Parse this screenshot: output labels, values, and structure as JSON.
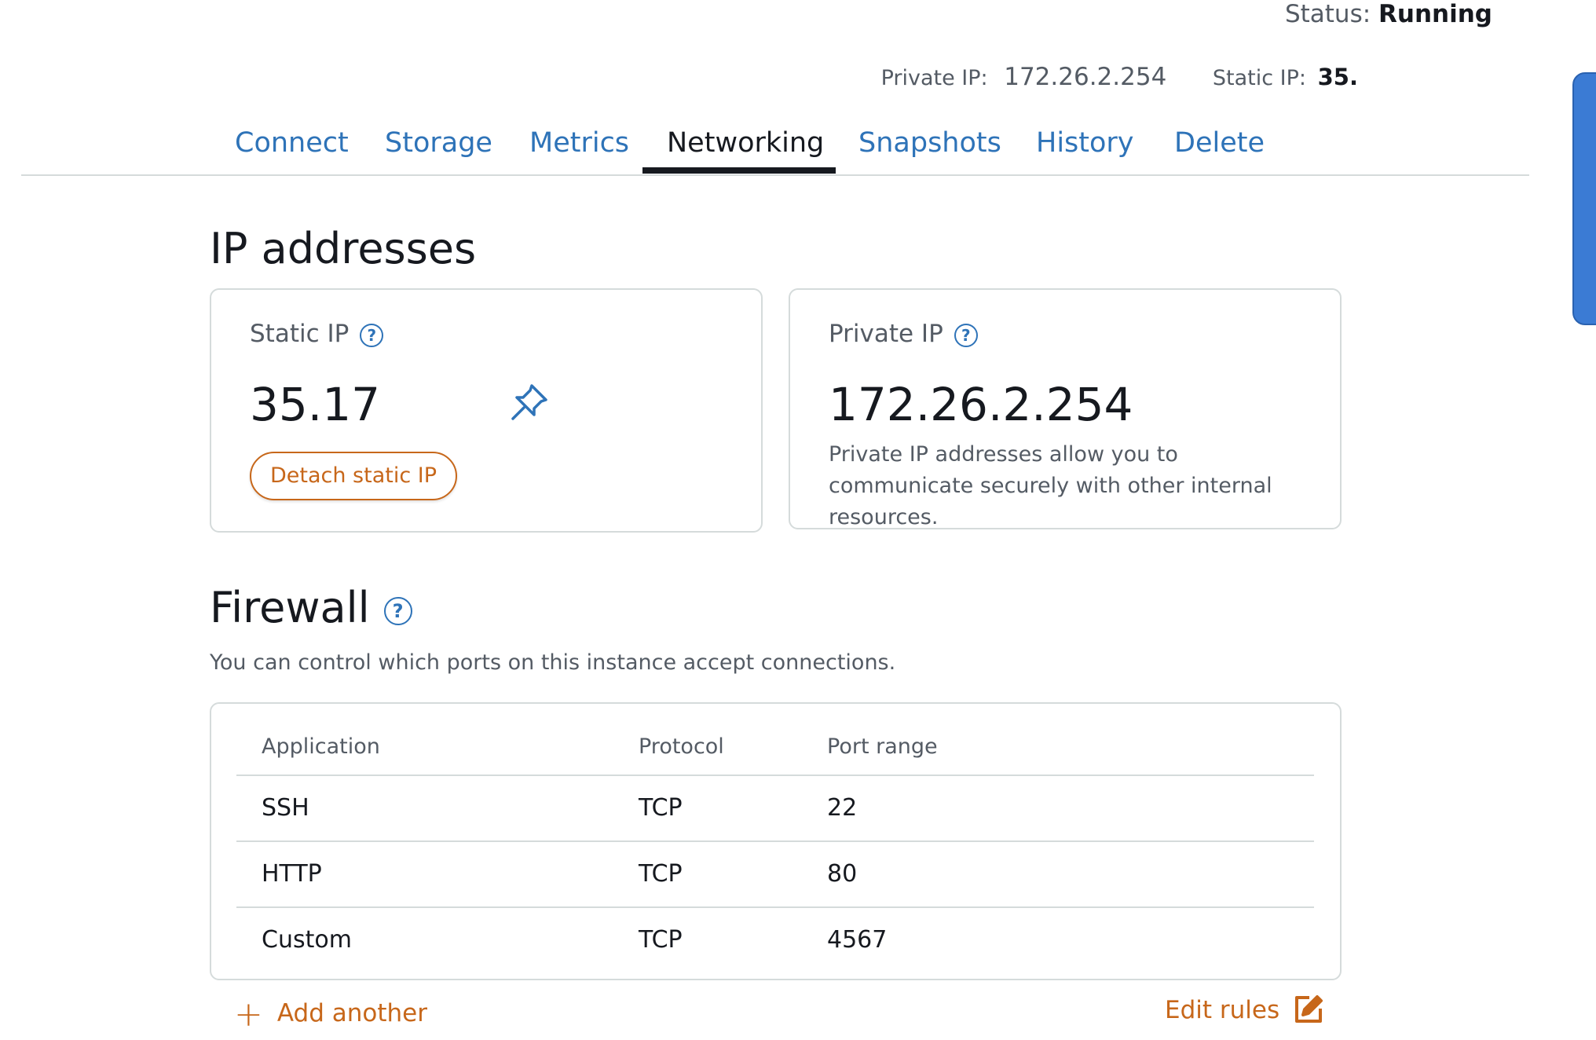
{
  "header": {
    "status_label": "Status:",
    "status_value": "Running",
    "private_ip_label": "Private IP:",
    "private_ip_value": "172.26.2.254",
    "static_ip_label": "Static IP:",
    "static_ip_value": "35."
  },
  "tabs": [
    {
      "label": "Connect"
    },
    {
      "label": "Storage"
    },
    {
      "label": "Metrics"
    },
    {
      "label": "Networking",
      "active": true
    },
    {
      "label": "Snapshots"
    },
    {
      "label": "History"
    },
    {
      "label": "Delete"
    }
  ],
  "ip_addresses": {
    "title": "IP addresses",
    "static_card": {
      "label": "Static IP",
      "value": "35.17",
      "detach_label": "Detach static IP"
    },
    "private_card": {
      "label": "Private IP",
      "value": "172.26.2.254",
      "description": "Private IP addresses allow you to communicate securely with other internal resources."
    }
  },
  "firewall": {
    "title": "Firewall",
    "description": "You can control which ports on this instance accept connections.",
    "columns": [
      "Application",
      "Protocol",
      "Port range"
    ],
    "rows": [
      {
        "application": "SSH",
        "protocol": "TCP",
        "port_range": "22"
      },
      {
        "application": "HTTP",
        "protocol": "TCP",
        "port_range": "80"
      },
      {
        "application": "Custom",
        "protocol": "TCP",
        "port_range": "4567"
      }
    ],
    "add_another_label": "Add another",
    "edit_rules_label": "Edit rules"
  },
  "colors": {
    "link_blue": "#2e73b8",
    "accent_orange": "#c7671a",
    "text_dark": "#16191f",
    "text_muted": "#545b64",
    "border": "#d5dbdb"
  },
  "icons": [
    "help-icon",
    "pin-icon",
    "plus-icon",
    "edit-icon"
  ]
}
